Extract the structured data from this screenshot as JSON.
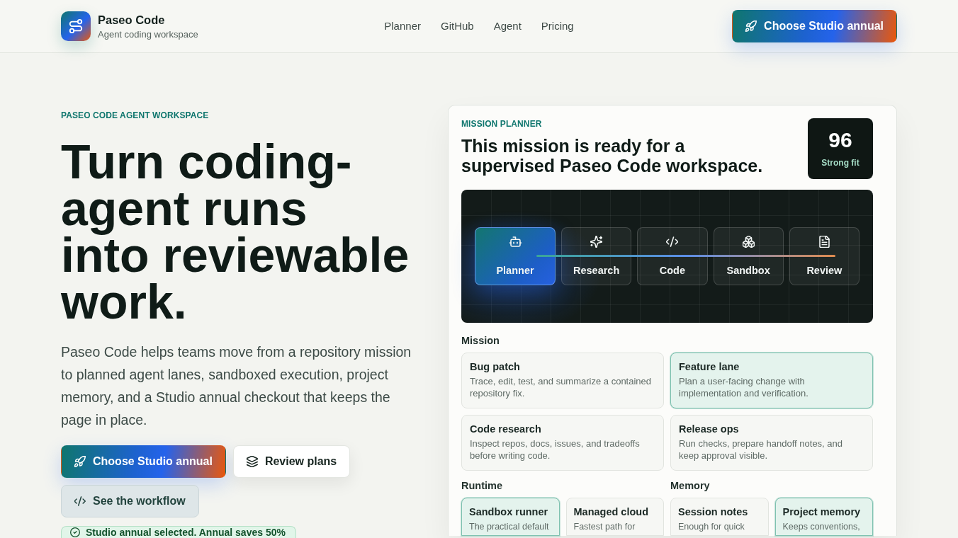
{
  "header": {
    "brand": {
      "name": "Paseo Code",
      "tagline": "Agent coding workspace"
    },
    "nav": [
      "Planner",
      "GitHub",
      "Agent",
      "Pricing"
    ],
    "cta": "Choose Studio annual"
  },
  "hero": {
    "eyebrow": "PASEO CODE AGENT WORKSPACE",
    "headline_lines": [
      "Turn coding-",
      "agent runs",
      "into reviewable",
      "work."
    ],
    "description": "Paseo Code helps teams move from a repository mission to planned agent lanes, sandboxed execution, project memory, and a Studio annual checkout that keeps the page in place.",
    "buttons": [
      {
        "label": "Choose Studio annual",
        "kind": "primary"
      },
      {
        "label": "Review plans",
        "kind": "secondary"
      },
      {
        "label": "See the workflow",
        "kind": "ghost"
      }
    ],
    "notice": "Studio annual selected. Annual saves 50%"
  },
  "planner": {
    "eyebrow": "MISSION PLANNER",
    "title": "This mission is ready for a supervised Paseo Code workspace.",
    "score": {
      "value": "96",
      "label": "Strong fit"
    },
    "steps": [
      {
        "label": "Planner",
        "selected": true
      },
      {
        "label": "Research",
        "selected": false
      },
      {
        "label": "Code",
        "selected": false
      },
      {
        "label": "Sandbox",
        "selected": false
      },
      {
        "label": "Review",
        "selected": false
      }
    ],
    "mission": {
      "label": "Mission",
      "options": [
        {
          "title": "Bug patch",
          "description": "Trace, edit, test, and summarize a contained repository fix.",
          "selected": false
        },
        {
          "title": "Feature lane",
          "description": "Plan a user-facing change with implementation and verification.",
          "selected": true
        },
        {
          "title": "Code research",
          "description": "Inspect repos, docs, issues, and tradeoffs before writing code.",
          "selected": false
        },
        {
          "title": "Release ops",
          "description": "Run checks, prepare handoff notes, and keep approval visible.",
          "selected": false
        }
      ]
    },
    "runtime": {
      "label": "Runtime",
      "options": [
        {
          "title": "Sandbox runner",
          "description": "The practical default",
          "selected": true
        },
        {
          "title": "Managed cloud",
          "description": "Fastest path for",
          "selected": false
        }
      ]
    },
    "memory": {
      "label": "Memory",
      "options": [
        {
          "title": "Session notes",
          "description": "Enough for quick",
          "selected": false
        },
        {
          "title": "Project memory",
          "description": "Keeps conventions,",
          "selected": true
        }
      ]
    }
  }
}
